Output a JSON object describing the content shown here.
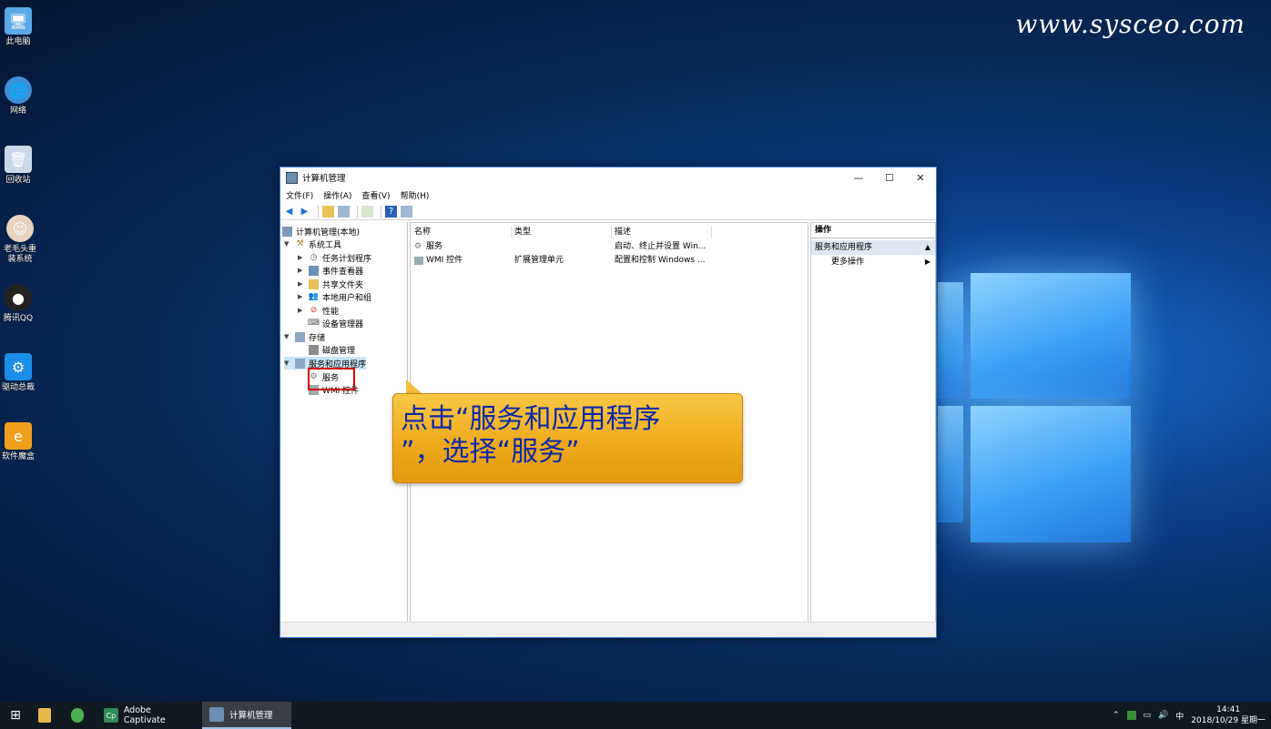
{
  "watermark": "www.sysceo.com",
  "desktop_icons": [
    {
      "label": "此电脑"
    },
    {
      "label": "网络"
    },
    {
      "label": "回收站"
    },
    {
      "label": "老毛头重装系统"
    },
    {
      "label": "腾讯QQ"
    },
    {
      "label": "驱动总裁"
    },
    {
      "label": "软件魔盒"
    }
  ],
  "window": {
    "title": "计算机管理",
    "controls": {
      "minimize": "—",
      "maximize": "☐",
      "close": "✕"
    },
    "menu": [
      "文件(F)",
      "操作(A)",
      "查看(V)",
      "帮助(H)"
    ],
    "tree": [
      {
        "label": "计算机管理(本地)"
      },
      {
        "label": "系统工具"
      },
      {
        "label": "任务计划程序"
      },
      {
        "label": "事件查看器"
      },
      {
        "label": "共享文件夹"
      },
      {
        "label": "本地用户和组"
      },
      {
        "label": "性能"
      },
      {
        "label": "设备管理器"
      },
      {
        "label": "存储"
      },
      {
        "label": "磁盘管理"
      },
      {
        "label": "服务和应用程序"
      },
      {
        "label": "服务"
      },
      {
        "label": "WMI 控件"
      }
    ],
    "list": {
      "columns": [
        "名称",
        "类型",
        "描述"
      ],
      "rows": [
        {
          "name": "服务",
          "type": "",
          "desc": "启动、终止并设置 Win..."
        },
        {
          "name": "WMI 控件",
          "type": "扩展管理单元",
          "desc": "配置和控制 Windows ..."
        }
      ]
    },
    "actions": {
      "header": "操作",
      "group": "服务和应用程序",
      "item": "更多操作"
    }
  },
  "callout": {
    "line1": "点击“服务和应用程序",
    "line2": "”，选择“服务”"
  },
  "taskbar": {
    "apps": [
      {
        "label": "Adobe Captivate"
      },
      {
        "label": "计算机管理"
      }
    ],
    "tray": {
      "ime": "中",
      "time": "14:41",
      "date": "2018/10/29 星期一"
    }
  }
}
